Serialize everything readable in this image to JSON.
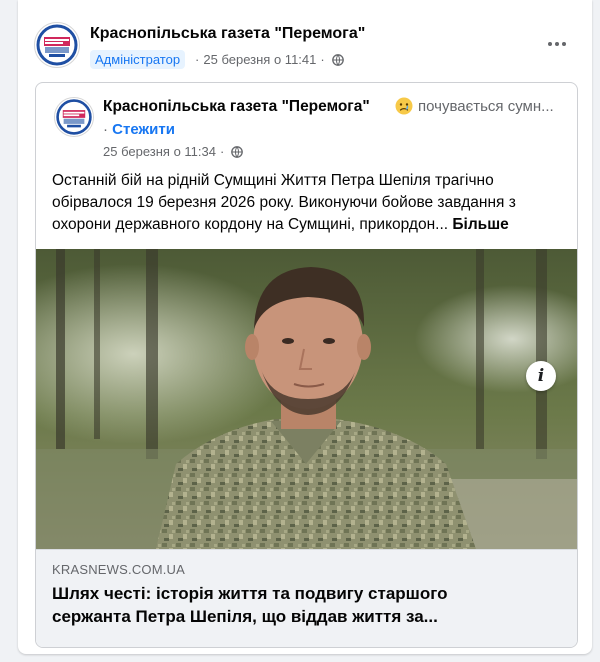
{
  "post": {
    "page_name": "Краснопільська газета \"Перемога\"",
    "role_badge": "Адміністратор",
    "separator": "·",
    "timestamp": "25 березня о 11:41"
  },
  "shared": {
    "page_name": "Краснопільська газета \"Перемога\"",
    "feeling": "почувається сумн...",
    "follow_prefix": "·",
    "follow_label": "Стежити",
    "timestamp": "25 березня о 11:34",
    "separator": "·",
    "text_line1": "Останній бій на рідній Сумщині Життя Петра Шепіля трагічно",
    "text_line2": "обірвалося 19 березня 2026 року. Виконуючи бойове завдання з",
    "text_line3": "охорони державного кордону на Сумщині, прикордон...",
    "more_label": "Більше",
    "info_icon": "i",
    "link": {
      "domain": "KRASNEWS.COM.UA",
      "title_line1": "Шлях честі: історія життя та подвигу старшого",
      "title_line2": "сержанта Петра Шепіля, що віддав життя за..."
    }
  },
  "icons": {
    "globe": "globe-icon",
    "more": "more-options-icon",
    "feeling": "sad-face-emoji-icon",
    "info": "info-icon"
  },
  "colors": {
    "accent": "#1877f2",
    "secondary_text": "#65676b",
    "link_preview_bg": "#f0f2f5"
  }
}
